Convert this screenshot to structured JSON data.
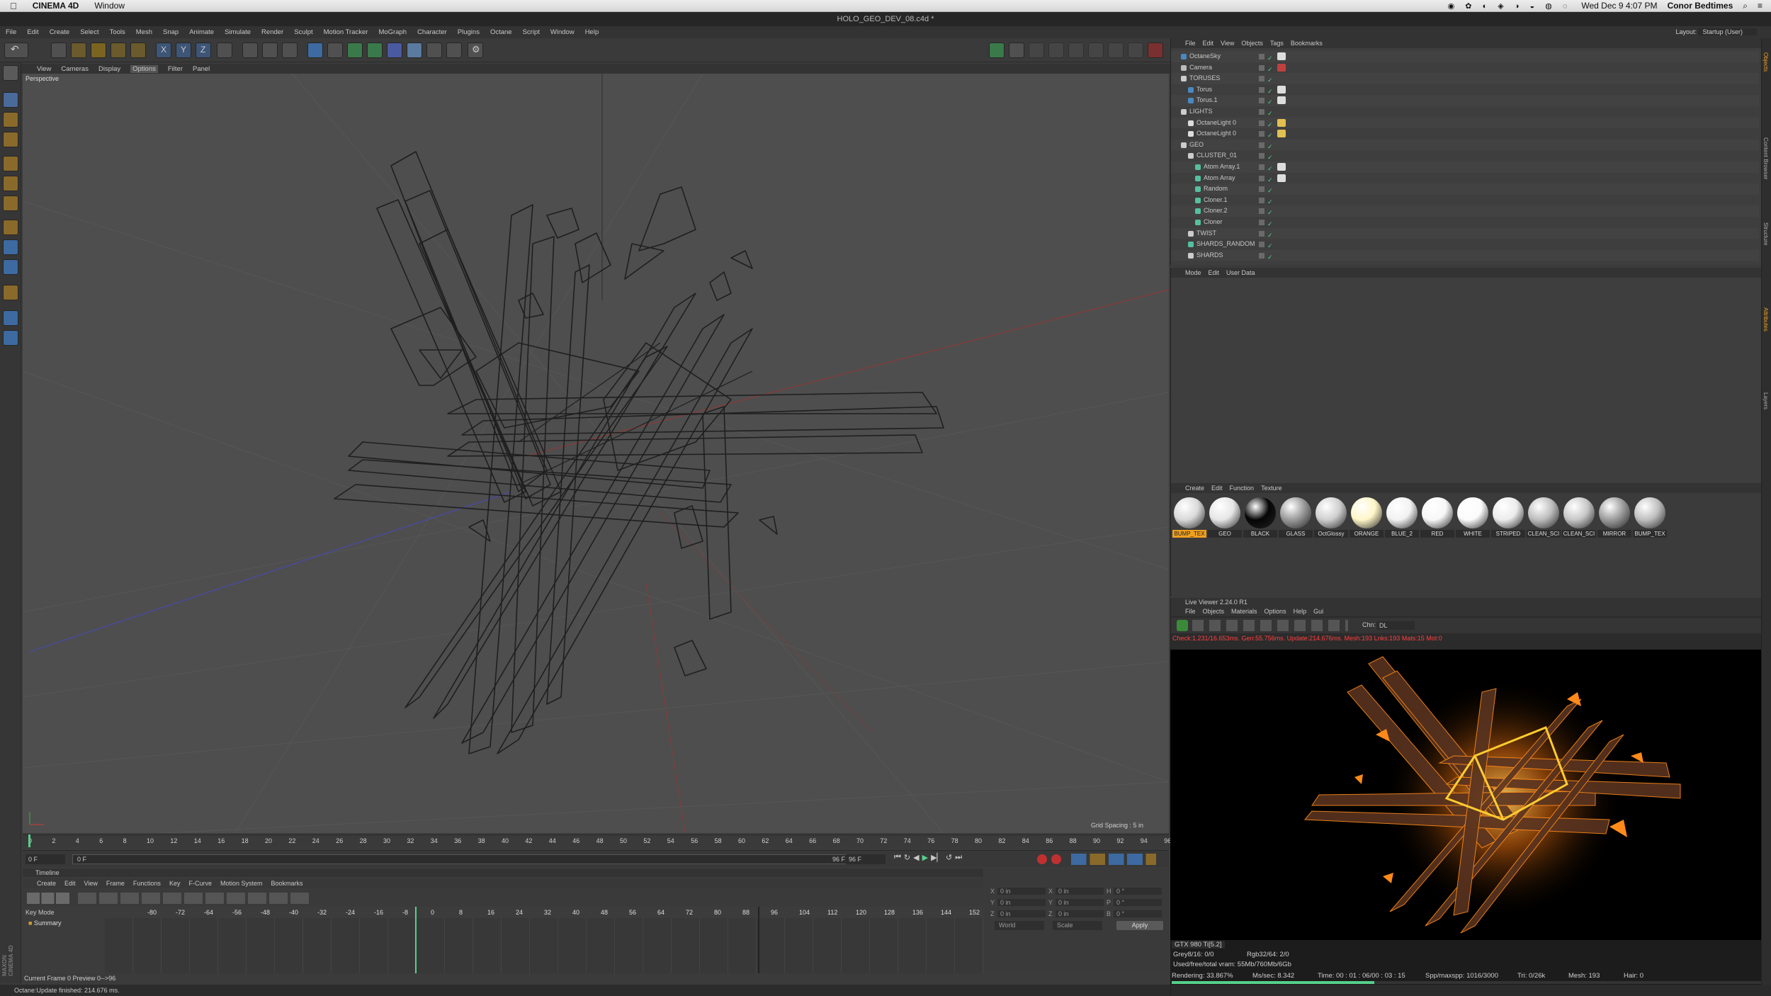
{
  "mac_bar": {
    "app_name": "CINEMA 4D",
    "window_menu": "Window",
    "clock": "Wed Dec 9  4:07 PM",
    "user": "Conor Bedtimes"
  },
  "title": "HOLO_GEO_DEV_08.c4d *",
  "menus": [
    "File",
    "Edit",
    "Create",
    "Select",
    "Tools",
    "Mesh",
    "Snap",
    "Animate",
    "Simulate",
    "Render",
    "Sculpt",
    "Motion Tracker",
    "MoGraph",
    "Character",
    "Plugins",
    "Octane",
    "Script",
    "Window",
    "Help"
  ],
  "viewport": {
    "menus": [
      "View",
      "Cameras",
      "Display",
      "Options",
      "Filter",
      "Panel"
    ],
    "label": "Perspective",
    "grid_spacing": "Grid Spacing : 5 in"
  },
  "timeline_ruler": [
    "0",
    "2",
    "4",
    "6",
    "8",
    "10",
    "12",
    "14",
    "16",
    "18",
    "20",
    "22",
    "24",
    "26",
    "28",
    "30",
    "32",
    "34",
    "36",
    "38",
    "40",
    "42",
    "44",
    "46",
    "48",
    "50",
    "52",
    "54",
    "56",
    "58",
    "60",
    "62",
    "64",
    "66",
    "68",
    "70",
    "72",
    "74",
    "76",
    "78",
    "80",
    "82",
    "84",
    "86",
    "88",
    "90",
    "92",
    "94",
    "96"
  ],
  "playback": {
    "current": "0 F",
    "start": "0 F",
    "end": "96 F",
    "end2": "96 F",
    "right_field": "0 F"
  },
  "timeline": {
    "title": "Timeline",
    "menus": [
      "Create",
      "Edit",
      "View",
      "Frame",
      "Functions",
      "Key",
      "F-Curve",
      "Motion System",
      "Bookmarks"
    ],
    "key_mode": "Key Mode",
    "summary": "Summary",
    "ruler": [
      "-80",
      "-72",
      "-64",
      "-56",
      "-48",
      "-40",
      "-32",
      "-24",
      "-16",
      "-8",
      "0",
      "8",
      "16",
      "24",
      "32",
      "40",
      "48",
      "56",
      "64",
      "72",
      "80",
      "88",
      "96",
      "104",
      "112",
      "120",
      "128",
      "136",
      "144",
      "152"
    ],
    "current_frame": "Current Frame  0  Preview  0-->96"
  },
  "coords": {
    "rows": [
      [
        "X",
        "0 in",
        "X",
        "0 in",
        "H",
        "0 °"
      ],
      [
        "Y",
        "0 in",
        "Y",
        "0 in",
        "P",
        "0 °"
      ],
      [
        "Z",
        "0 in",
        "Z",
        "0 in",
        "B",
        "0 °"
      ]
    ],
    "world": "World",
    "scale": "Scale",
    "apply": "Apply"
  },
  "status_bar": "Octane:Update finished: 214.676 ms.",
  "brand": "MAXON CINEMA 4D",
  "layout": {
    "label": "Layout:",
    "value": "Startup (User)"
  },
  "object_manager": {
    "menus": [
      "File",
      "Edit",
      "View",
      "Objects",
      "Tags",
      "Bookmarks"
    ],
    "objects": [
      {
        "name": "OctaneSky",
        "depth": 0,
        "icon": "sky"
      },
      {
        "name": "Camera",
        "depth": 0,
        "icon": "camera"
      },
      {
        "name": "TORUSES",
        "depth": 0,
        "icon": "null"
      },
      {
        "name": "Torus",
        "depth": 1,
        "icon": "torus"
      },
      {
        "name": "Torus.1",
        "depth": 1,
        "icon": "torus"
      },
      {
        "name": "LIGHTS",
        "depth": 0,
        "icon": "null"
      },
      {
        "name": "OctaneLight 0",
        "depth": 1,
        "icon": "light"
      },
      {
        "name": "OctaneLight 0",
        "depth": 1,
        "icon": "light"
      },
      {
        "name": "GEO",
        "depth": 0,
        "icon": "null"
      },
      {
        "name": "CLUSTER_01",
        "depth": 1,
        "icon": "null"
      },
      {
        "name": "Atom Array.1",
        "depth": 2,
        "icon": "atom"
      },
      {
        "name": "Atom Array",
        "depth": 2,
        "icon": "atom"
      },
      {
        "name": "Random",
        "depth": 2,
        "icon": "effector"
      },
      {
        "name": "Cloner.1",
        "depth": 2,
        "icon": "cloner"
      },
      {
        "name": "Cloner.2",
        "depth": 2,
        "icon": "cloner"
      },
      {
        "name": "Cloner",
        "depth": 2,
        "icon": "cloner"
      },
      {
        "name": "TWIST",
        "depth": 1,
        "icon": "null"
      },
      {
        "name": "SHARDS_RANDOM",
        "depth": 1,
        "icon": "effector"
      },
      {
        "name": "SHARDS",
        "depth": 1,
        "icon": "null"
      }
    ]
  },
  "attribute_manager": {
    "menus": [
      "Mode",
      "Edit",
      "User Data"
    ]
  },
  "material_manager": {
    "menus": [
      "Create",
      "Edit",
      "Function",
      "Texture"
    ],
    "materials": [
      {
        "name": "BUMP_TEX",
        "color": "#d9d9d9",
        "selected": true
      },
      {
        "name": "GEO",
        "color": "#e6e6e6"
      },
      {
        "name": "BLACK",
        "color": "#050505"
      },
      {
        "name": "GLASS",
        "color": "#9a9a9a"
      },
      {
        "name": "OctGlossy",
        "color": "#cfcfcf"
      },
      {
        "name": "ORANGE",
        "color": "#fff6c8"
      },
      {
        "name": "BLUE_2",
        "color": "#f2f2f2"
      },
      {
        "name": "RED",
        "color": "#f7f7f7"
      },
      {
        "name": "WHITE",
        "color": "#fbfbfb"
      },
      {
        "name": "STRIPED",
        "color": "#ececec"
      },
      {
        "name": "CLEAN_SCI",
        "color": "#bdbdbd"
      },
      {
        "name": "CLEAN_SCI",
        "color": "#c7c7c7"
      },
      {
        "name": "MIRROR",
        "color": "#9c9c9c"
      },
      {
        "name": "BUMP_TEX",
        "color": "#bfbfbf"
      }
    ]
  },
  "live_viewer": {
    "title": "Live Viewer 2.24.0 R1",
    "menus": [
      "File",
      "Objects",
      "Materials",
      "Options",
      "Help",
      "Gui"
    ],
    "chn_label": "Chn:",
    "chn_value": "DL",
    "check_line": "Check:1.231/16.653ms. Gen:55.756ms. Update:214.676ms. Mesh:193 Lnks:193 Mats:15 Mot:0",
    "gpu": "GTX 980 Ti[5.2]",
    "grey": "Grey8/16: 0/0",
    "rgb": "Rgb32/64: 2/0",
    "vram": "Used/free/total vram: 55Mb/760Mb/6Gb",
    "rendering": "Rendering: 33.867%",
    "ms_sec": "Ms/sec: 8.342",
    "time": "Time: 00 : 01 : 06/00 : 03 : 15",
    "spp": "Spp/maxspp: 1016/3000",
    "tri": "Tri: 0/26k",
    "mesh": "Mesh: 193",
    "hair": "Hair: 0",
    "progress": 0.339
  },
  "right_tabs": [
    "Objects",
    "Content Browser",
    "Structure",
    "Attributes",
    "Layers"
  ],
  "colors": {
    "accent": "#f0a020",
    "timeline_marker": "#55d08a",
    "render_orange": "#ff8a1a",
    "error_text": "#ff4040"
  }
}
